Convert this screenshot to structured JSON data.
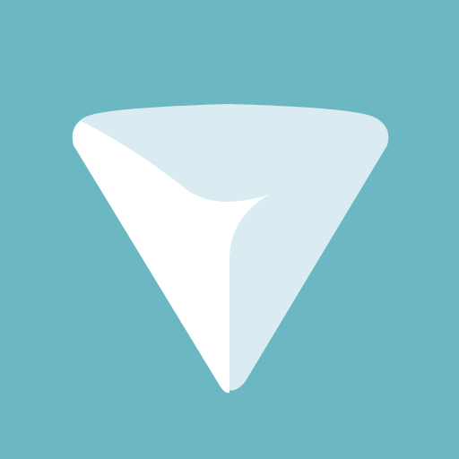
{
  "app_icon": {
    "icon": "paper-plane-triangle-icon",
    "colors": {
      "background": "#6bb8c2",
      "light_face": "#daecf1",
      "white_face": "#ffffff"
    }
  }
}
